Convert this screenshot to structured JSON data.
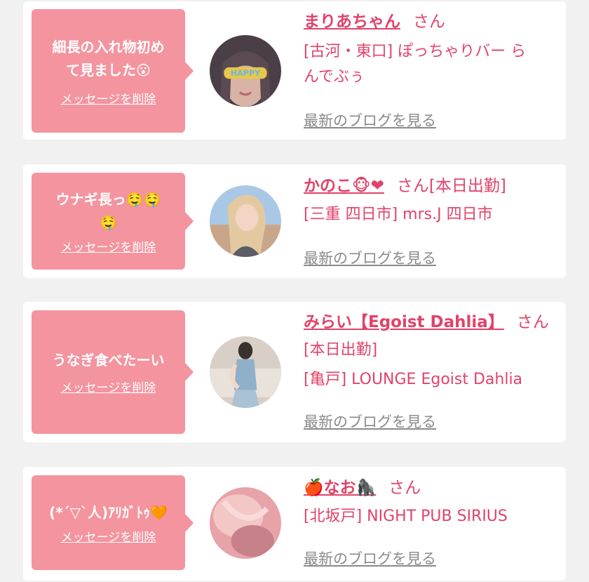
{
  "delete_label": "メッセージを削除",
  "blog_label": "最新のブログを見る",
  "san_label": "さん",
  "colors": {
    "background": "#f1f1f1",
    "bubble": "#f4949f",
    "accent": "#e0436a",
    "link_gray": "#8a8a8a"
  },
  "items": [
    {
      "message_line1": "細長の入れ物初め",
      "message_line2": "て見ました😮",
      "name": "まりあちゃん",
      "san_suffix": "",
      "sub1": "[古河・東口] ぽっちゃりバー ら",
      "sub2": "んでぶぅ",
      "avatar_icon": "girl-happy-glasses-avatar"
    },
    {
      "message_line1": "ウナギ長っ🤤🤤",
      "message_line2": "🤤",
      "name": "かのこ🐵❤",
      "san_suffix": "[本日出勤]",
      "sub1": "[三重 四日市] mrs.J 四日市",
      "sub2": "",
      "avatar_icon": "woman-portrait-avatar"
    },
    {
      "message_line1": "うなぎ食べたーい",
      "message_line2": "",
      "name": "みらい【Egoist Dahlia】",
      "san_suffix": "",
      "sub1": "[本日出勤]",
      "sub2": "[亀戸] LOUNGE Egoist Dahlia",
      "avatar_icon": "woman-on-sofa-avatar"
    },
    {
      "message_line1": "(*´▽`人)ｱﾘｶﾞﾄｩ🧡",
      "message_line2": "",
      "name": "🍎なお🦍",
      "san_suffix": "",
      "sub1": "[北坂戸] NIGHT PUB SIRIUS",
      "sub2": "",
      "avatar_icon": "blurred-pink-avatar"
    }
  ]
}
